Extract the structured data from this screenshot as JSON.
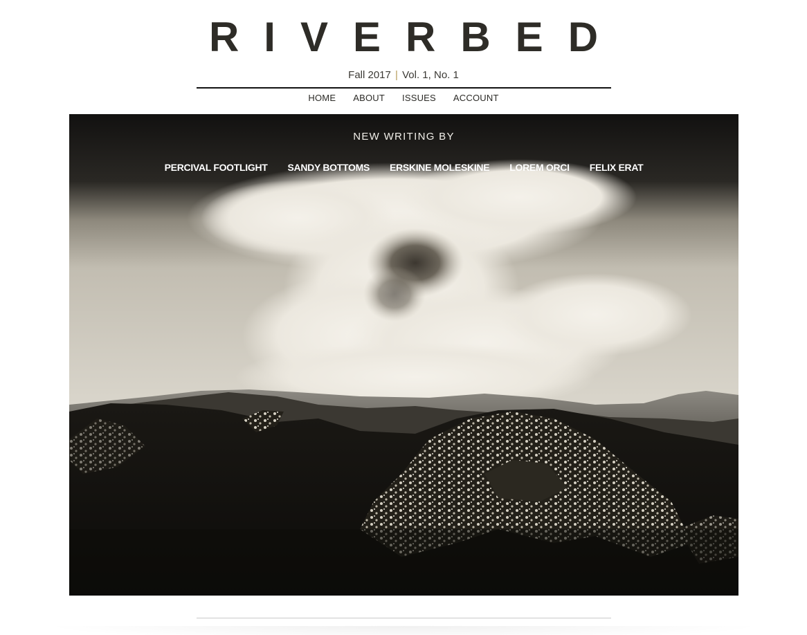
{
  "header": {
    "title": "RIVERBED",
    "issue_season": "Fall 2017",
    "issue_separator": "|",
    "issue_volume": "Vol. 1, No. 1"
  },
  "nav": {
    "home": "HOME",
    "about": "ABOUT",
    "issues": "ISSUES",
    "account": "ACCOUNT"
  },
  "hero": {
    "heading": "NEW WRITING BY",
    "authors": [
      "PERCIVAL FOOTLIGHT",
      "SANDY BOTTOMS",
      "ERSKINE MOLESKINE",
      "LOREM ORCI",
      "FELIX ERAT"
    ]
  },
  "colors": {
    "text": "#2b2a26",
    "rule": "#111111",
    "separator": "#b59a5a",
    "hero_dark": "#15130f",
    "hero_light": "#e8e4da"
  }
}
